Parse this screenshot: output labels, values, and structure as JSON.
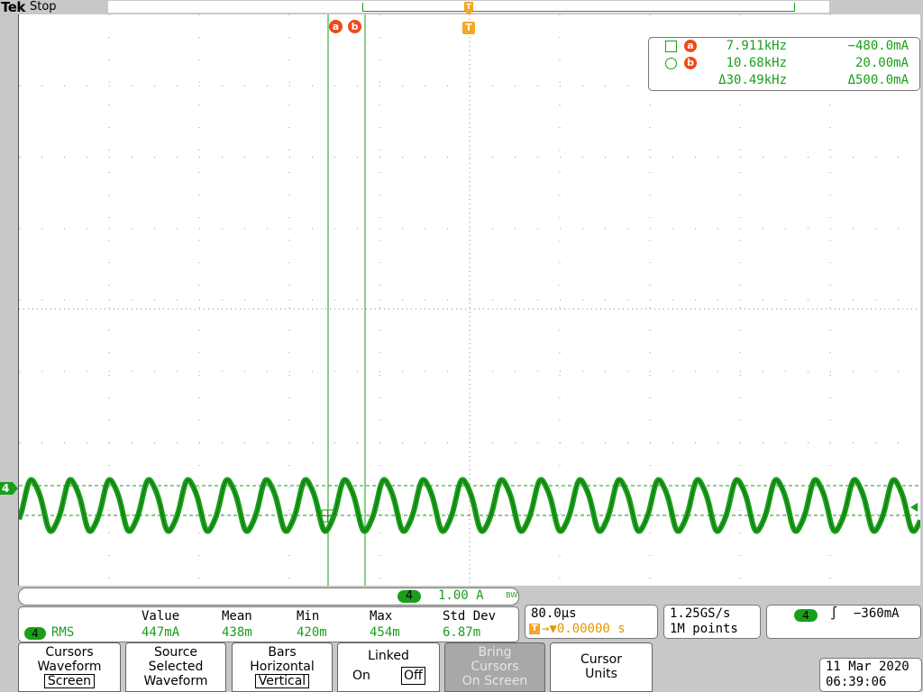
{
  "status": {
    "brand": "Tek",
    "run_state": "Stop"
  },
  "cursors": {
    "a_label": "a",
    "b_label": "b",
    "trigger_label": "T",
    "readout": {
      "a": {
        "freq": "7.911kHz",
        "amp": "−480.0mA"
      },
      "b": {
        "freq": "10.68kHz",
        "amp": "20.00mA"
      },
      "delta": {
        "freq": "Δ30.49kHz",
        "amp": "Δ500.0mA"
      }
    }
  },
  "channel": {
    "number": "4",
    "scale": "1.00 A",
    "bw_label": "BW"
  },
  "measurement": {
    "headers": [
      "Value",
      "Mean",
      "Min",
      "Max",
      "Std Dev"
    ],
    "channel": "4",
    "name": "RMS",
    "values": [
      "447mA",
      "438m",
      "420m",
      "454m",
      "6.87m"
    ]
  },
  "timebase": {
    "scale": "80.0μs",
    "position": "→▼0.00000 s"
  },
  "acquisition": {
    "sample_rate": "1.25GS/s",
    "record_length": "1M points"
  },
  "trigger": {
    "channel": "4",
    "slope": "∫",
    "level": "−360mA"
  },
  "menu": {
    "cursors": {
      "line1": "Cursors",
      "line2": "Waveform",
      "selected": "Screen"
    },
    "source": {
      "line1": "Source",
      "line2": "Selected",
      "line3": "Waveform"
    },
    "bars": {
      "line1": "Bars",
      "line2": "Horizontal",
      "selected": "Vertical"
    },
    "linked": {
      "line1": "Linked",
      "on": "On",
      "off": "Off"
    },
    "bring": {
      "line1": "Bring",
      "line2": "Cursors",
      "line3": "On Screen"
    },
    "units": {
      "line1": "Cursor",
      "line2": "Units"
    }
  },
  "datetime": {
    "date": "11 Mar 2020",
    "time": "06:39:06"
  },
  "colors": {
    "trace": "#1a9e1a",
    "cursor_badge": "#ee4a17",
    "trigger": "#f5a623"
  }
}
